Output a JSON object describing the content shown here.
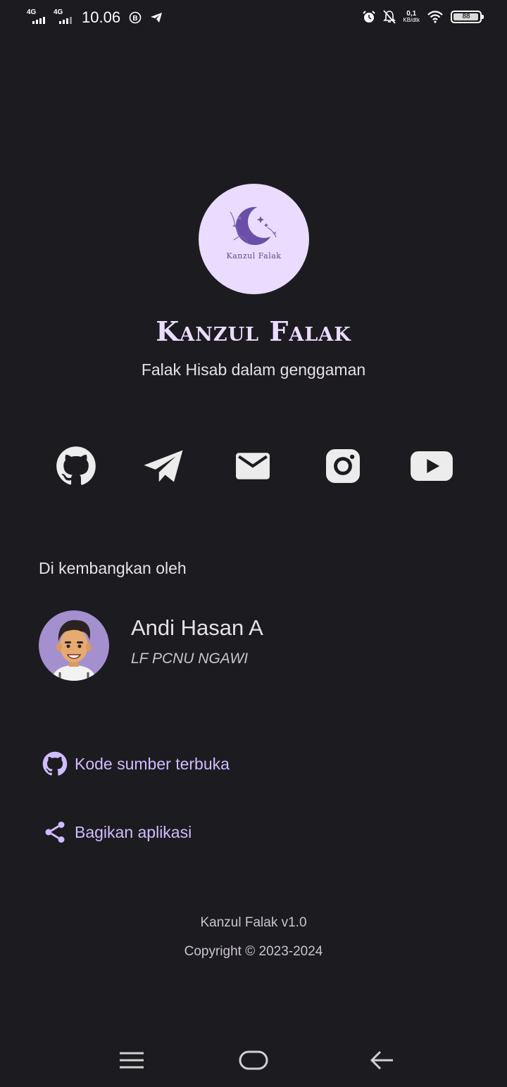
{
  "status_bar": {
    "network1": "4G",
    "network2": "4G",
    "time": "10.06",
    "net_speed_value": "0,1",
    "net_speed_unit": "KB/dtk",
    "battery": "88"
  },
  "app": {
    "logo_text": "Kanzul Falak",
    "title": "Kanzul Falak",
    "tagline": "Falak Hisab dalam genggaman"
  },
  "social_icons": [
    "github-icon",
    "telegram-icon",
    "mail-icon",
    "instagram-icon",
    "youtube-icon"
  ],
  "developer": {
    "section_label": "Di kembangkan oleh",
    "name": "Andi Hasan A",
    "organization": "LF PCNU NGAWI"
  },
  "links": {
    "source_code": "Kode sumber terbuka",
    "share": "Bagikan aplikasi"
  },
  "footer": {
    "version": "Kanzul Falak v1.0",
    "copyright": "Copyright © 2023-2024"
  },
  "colors": {
    "background": "#1c1b1f",
    "accent": "#d0bcff",
    "logo_bg": "#eadcff"
  }
}
